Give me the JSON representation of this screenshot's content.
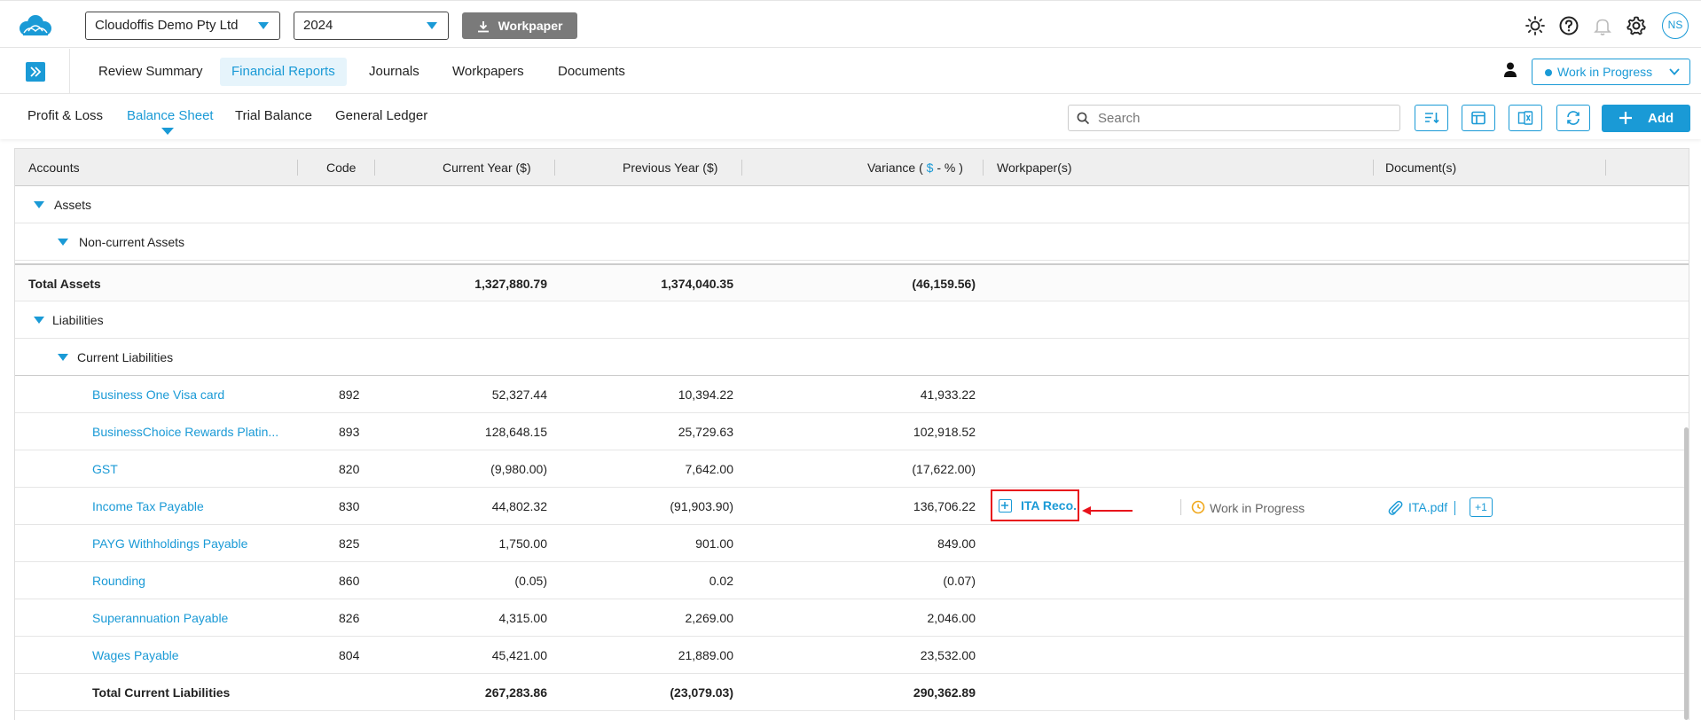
{
  "header": {
    "company": "Cloudoffis Demo Pty Ltd",
    "year": "2024",
    "workpaper_button": "Workpaper",
    "avatar_initials": "NS"
  },
  "nav": {
    "tabs": [
      "Review Summary",
      "Financial Reports",
      "Journals",
      "Workpapers",
      "Documents"
    ],
    "active_tab": "Financial Reports",
    "status": "Work in Progress"
  },
  "subnav": {
    "tabs": [
      "Profit & Loss",
      "Balance Sheet",
      "Trial Balance",
      "General Ledger"
    ],
    "active_tab": "Balance Sheet",
    "search_placeholder": "Search",
    "add_label": "Add"
  },
  "table": {
    "headers": {
      "accounts": "Accounts",
      "code": "Code",
      "current_year": "Current Year ($)",
      "previous_year": "Previous Year ($)",
      "variance_prefix": "Variance (",
      "variance_dollar": "$",
      "variance_suffix": " - % )",
      "workpapers": "Workpaper(s)",
      "documents": "Document(s)"
    },
    "groups": {
      "assets": "Assets",
      "non_current_assets": "Non-current Assets",
      "liabilities": "Liabilities",
      "current_liabilities": "Current Liabilities"
    },
    "total_assets": {
      "label": "Total Assets",
      "current": "1,327,880.79",
      "previous": "1,374,040.35",
      "variance": "(46,159.56)"
    },
    "rows": [
      {
        "account": "Business One Visa card",
        "code": "892",
        "current": "52,327.44",
        "previous": "10,394.22",
        "variance": "41,933.22"
      },
      {
        "account": "BusinessChoice Rewards Platin...",
        "code": "893",
        "current": "128,648.15",
        "previous": "25,729.63",
        "variance": "102,918.52"
      },
      {
        "account": "GST",
        "code": "820",
        "current": "(9,980.00)",
        "previous": "7,642.00",
        "variance": "(17,622.00)"
      },
      {
        "account": "Income Tax Payable",
        "code": "830",
        "current": "44,802.32",
        "previous": "(91,903.90)",
        "variance": "136,706.22"
      },
      {
        "account": "PAYG Withholdings Payable",
        "code": "825",
        "current": "1,750.00",
        "previous": "901.00",
        "variance": "849.00"
      },
      {
        "account": "Rounding",
        "code": "860",
        "current": "(0.05)",
        "previous": "0.02",
        "variance": "(0.07)"
      },
      {
        "account": "Superannuation Payable",
        "code": "826",
        "current": "4,315.00",
        "previous": "2,269.00",
        "variance": "2,046.00"
      },
      {
        "account": "Wages Payable",
        "code": "804",
        "current": "45,421.00",
        "previous": "21,889.00",
        "variance": "23,532.00"
      }
    ],
    "total_current_liabilities": {
      "label": "Total Current Liabilities",
      "current": "267,283.86",
      "previous": "(23,079.03)",
      "variance": "290,362.89"
    },
    "income_tax_row": {
      "workpaper": "ITA Reco.",
      "workpaper_status": "Work in Progress",
      "document": "ITA.pdf",
      "more_docs": "+1"
    }
  },
  "colors": {
    "accent": "#1a9ad6",
    "highlight": "#e8121b"
  }
}
